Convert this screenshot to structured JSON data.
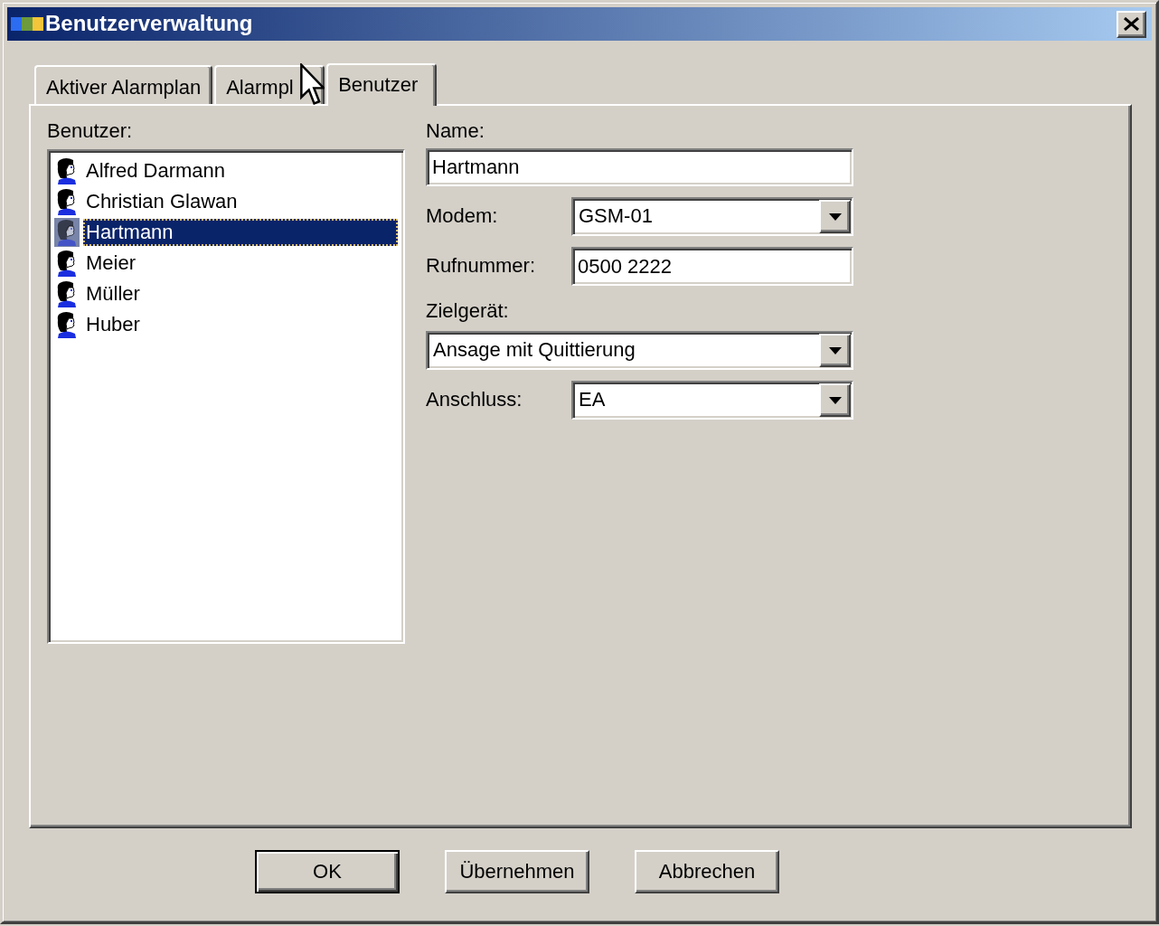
{
  "window": {
    "title": "Benutzerverwaltung"
  },
  "tabs": [
    {
      "label": "Aktiver Alarmplan",
      "selected": false
    },
    {
      "label": "Alarmpl",
      "selected": false
    },
    {
      "label": "Benutzer",
      "selected": true
    }
  ],
  "user_list": {
    "label": "Benutzer:",
    "items": [
      {
        "name": "Alfred Darmann",
        "selected": false
      },
      {
        "name": "Christian Glawan",
        "selected": false
      },
      {
        "name": "Hartmann",
        "selected": true
      },
      {
        "name": "Meier",
        "selected": false
      },
      {
        "name": "Müller",
        "selected": false
      },
      {
        "name": "Huber",
        "selected": false
      }
    ]
  },
  "fields": [
    {
      "label": "Name:",
      "kind": "text",
      "stacked": true,
      "value": "Hartmann"
    },
    {
      "label": "Modem:",
      "kind": "dropdown",
      "stacked": false,
      "value": "GSM-01"
    },
    {
      "label": "Rufnummer:",
      "kind": "text",
      "stacked": false,
      "value": "0500 2222"
    },
    {
      "label": "Zielgerät:",
      "kind": "dropdown",
      "stacked": true,
      "value": "Ansage mit Quittierung"
    },
    {
      "label": "Anschluss:",
      "kind": "dropdown",
      "stacked": false,
      "value": "EA"
    }
  ],
  "buttons": [
    {
      "label": "OK",
      "default": true
    },
    {
      "label": "Übernehmen",
      "default": false
    },
    {
      "label": "Abbrechen",
      "default": false
    }
  ]
}
